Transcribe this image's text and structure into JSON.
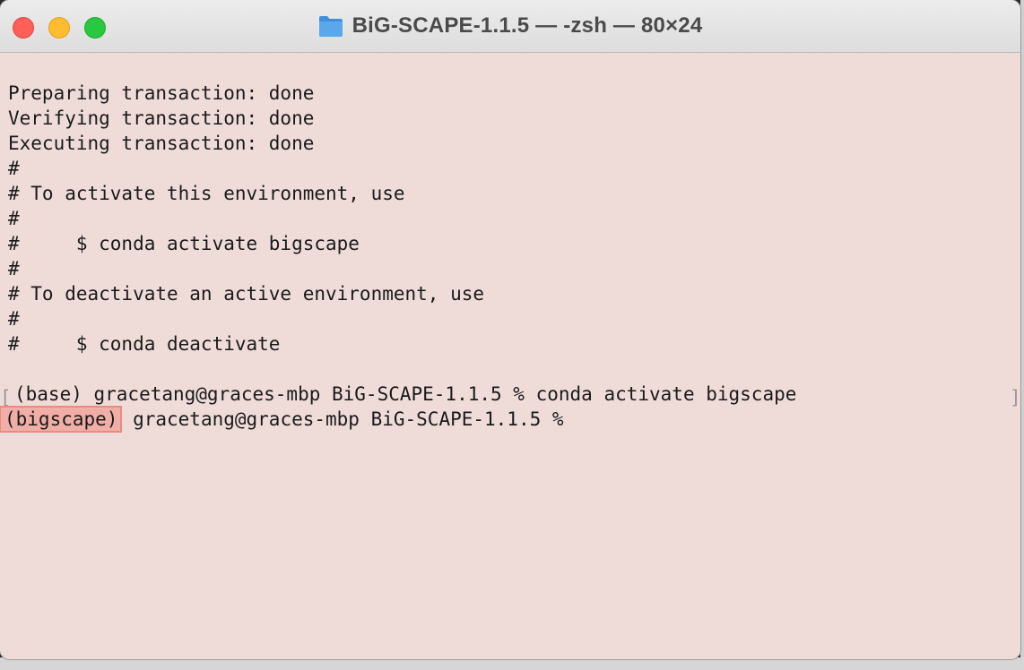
{
  "window": {
    "title": "BiG-SCAPE-1.1.5 — -zsh — 80×24",
    "title_icon": "folder-icon",
    "traffic_lights": [
      "close",
      "minimize",
      "zoom"
    ]
  },
  "terminal": {
    "lines": [
      "Preparing transaction: done",
      "Verifying transaction: done",
      "Executing transaction: done",
      "#",
      "# To activate this environment, use",
      "#",
      "#     $ conda activate bigscape",
      "#",
      "# To deactivate an active environment, use",
      "#",
      "#     $ conda deactivate",
      ""
    ],
    "command_line": "(base) gracetang@graces-mbp BiG-SCAPE-1.1.5 % conda activate bigscape",
    "current_prompt": {
      "env": "(bigscape)",
      "rest": " gracetang@graces-mbp BiG-SCAPE-1.1.5 %"
    }
  },
  "colors": {
    "terminal_background": "#efdcd9",
    "highlight": "#f0aea6",
    "text": "#1a1a1a"
  }
}
